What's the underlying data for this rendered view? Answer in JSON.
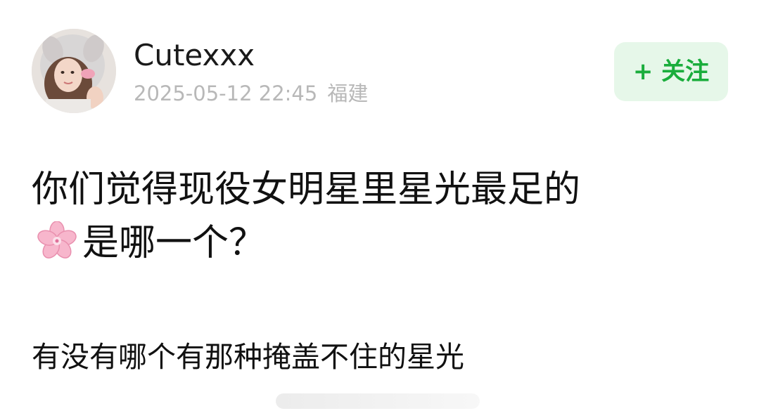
{
  "post": {
    "author": {
      "name": "Cutexxx",
      "avatar_icon": "user-avatar-photo"
    },
    "meta": {
      "timestamp": "2025-05-12 22:45",
      "location": "福建"
    },
    "follow_button": {
      "label": "+ 关注"
    },
    "title": {
      "line1": "你们觉得现役女明星里星光最足的",
      "line2": "是哪一个？",
      "emoji_icon": "cherry-blossom-icon"
    },
    "body": "有没有哪个有那种掩盖不住的星光"
  },
  "colors": {
    "accent_green": "#1aad3c",
    "follow_bg": "#e6f7e9",
    "meta_gray": "#b8b8b8",
    "text_dark": "#111111"
  }
}
